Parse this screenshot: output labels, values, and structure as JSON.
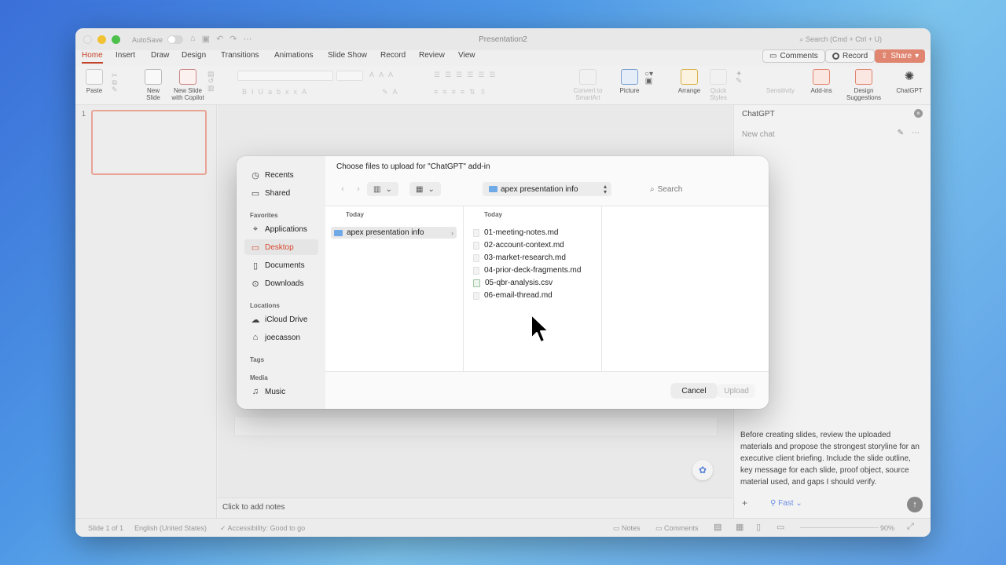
{
  "titlebar": {
    "autosave_label": "AutoSave",
    "document_title": "Presentation2",
    "search_placeholder": "Search (Cmd + Ctrl + U)"
  },
  "tabs": [
    "Home",
    "Insert",
    "Draw",
    "Design",
    "Transitions",
    "Animations",
    "Slide Show",
    "Record",
    "Review",
    "View"
  ],
  "active_tab": "Home",
  "header_buttons": {
    "comments": "Comments",
    "record": "Record",
    "share": "Share"
  },
  "ribbon": {
    "paste": "Paste",
    "new_slide": "New Slide",
    "new_slide_copilot": "New Slide with Copilot",
    "convert_smartart": "Convert to SmartArt",
    "picture": "Picture",
    "arrange": "Arrange",
    "quick_styles": "Quick Styles",
    "sensitivity": "Sensitivity",
    "addins": "Add-ins",
    "design_suggestions": "Design Suggestions",
    "chatgpt": "ChatGPT"
  },
  "thumbnail": {
    "number": "1"
  },
  "notes_placeholder": "Click to add notes",
  "pane": {
    "title": "ChatGPT",
    "new_chat": "New chat",
    "prompt": "Before creating slides, review the uploaded materials and propose the strongest storyline for an executive client briefing. Include the slide outline, key message for each slide, proof object, source material used, and gaps I should verify.",
    "mode": "Fast"
  },
  "statusbar": {
    "slide": "Slide 1 of 1",
    "language": "English (United States)",
    "accessibility": "Accessibility: Good to go",
    "notes": "Notes",
    "comments": "Comments",
    "zoom": "90%"
  },
  "dialog": {
    "title": "Choose files to upload for \"ChatGPT\" add-in",
    "path": "apex presentation info",
    "search_placeholder": "Search",
    "sidebar": {
      "top": [
        {
          "label": "Recents",
          "icon": "clock-icon"
        },
        {
          "label": "Shared",
          "icon": "shared-folder-icon"
        }
      ],
      "favorites_header": "Favorites",
      "favorites": [
        {
          "label": "Applications",
          "icon": "applications-icon"
        },
        {
          "label": "Desktop",
          "icon": "desktop-icon",
          "selected": true
        },
        {
          "label": "Documents",
          "icon": "document-icon"
        },
        {
          "label": "Downloads",
          "icon": "download-icon"
        }
      ],
      "locations_header": "Locations",
      "locations": [
        {
          "label": "iCloud Drive",
          "icon": "cloud-icon"
        },
        {
          "label": "joecasson",
          "icon": "home-icon"
        }
      ],
      "tags_header": "Tags",
      "media_header": "Media",
      "media": [
        {
          "label": "Music",
          "icon": "music-icon"
        }
      ]
    },
    "columns": [
      {
        "header": "Today",
        "items": [
          "apex presentation info"
        ]
      },
      {
        "header": "Today",
        "items": [
          "01-meeting-notes.md",
          "02-account-context.md",
          "03-market-research.md",
          "04-prior-deck-fragments.md",
          "05-qbr-analysis.csv",
          "06-email-thread.md"
        ]
      }
    ],
    "cancel": "Cancel",
    "upload": "Upload"
  },
  "colors": {
    "accent": "#c4442a",
    "share_button": "#e0856f",
    "selected_sidebar": "#d6492e",
    "folder": "#6fa9e6"
  }
}
